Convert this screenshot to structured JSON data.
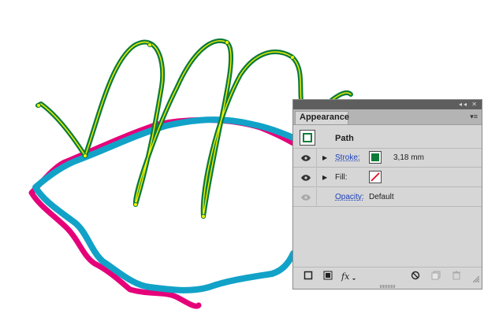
{
  "panel": {
    "tab_label": "Appearance",
    "window_controls": "◂◂ ✕",
    "menu_glyph": "▾≡",
    "selection_label": "Path",
    "stroke": {
      "label": "Stroke:",
      "value": "3,18 mm",
      "color": "#0d7c3a"
    },
    "fill": {
      "label": "Fill:",
      "value": "none"
    },
    "opacity": {
      "label": "Opacity:",
      "value": "Default"
    },
    "bottom_icons": [
      "add-new-stroke-icon",
      "add-new-fill-icon",
      "add-effect-icon",
      "clear-appearance-icon",
      "duplicate-item-icon",
      "delete-item-icon"
    ]
  },
  "artwork": {
    "green_path_color": "#0d7c3a",
    "green_path_inner_color": "#f2f200",
    "magenta_path_color": "#e5007a",
    "blue_path_color": "#12a2c8"
  }
}
